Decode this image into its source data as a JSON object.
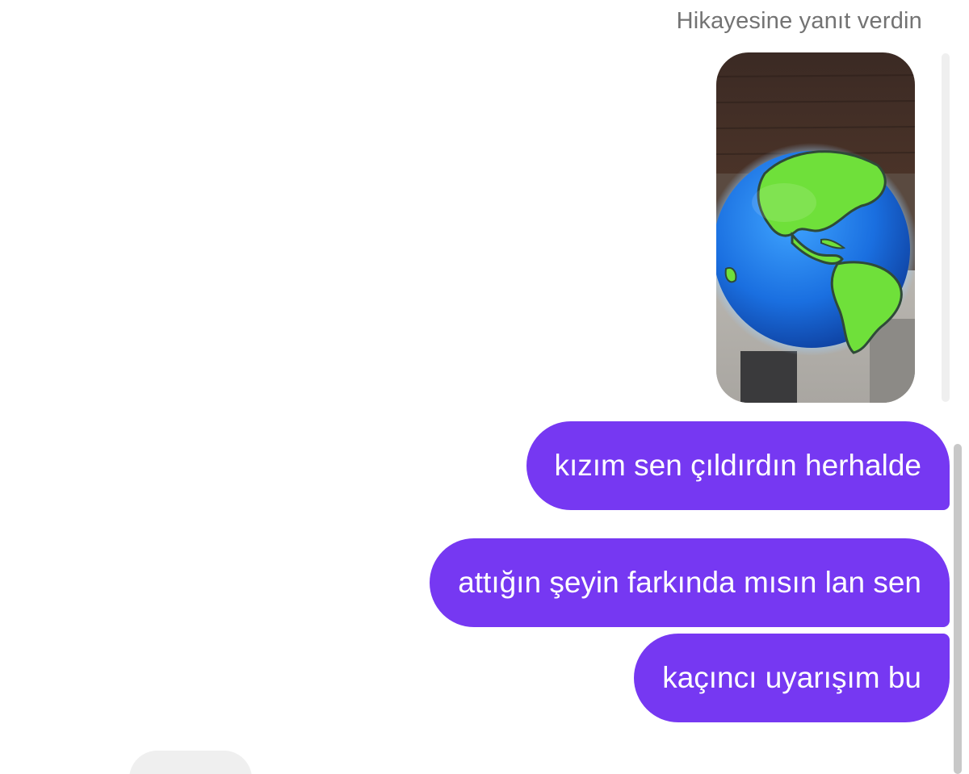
{
  "story_reply": {
    "caption": "Hikayesine yanıt verdin",
    "thumbnail_icon": "earth-globe-icon"
  },
  "messages": [
    {
      "text": "kızım sen çıldırdın herhalde",
      "sender": "me"
    },
    {
      "text": "attığın şeyin farkında mısın lan sen",
      "sender": "me"
    },
    {
      "text": "kaçıncı uyarışım bu",
      "sender": "me"
    }
  ],
  "colors": {
    "sent_bubble": "#7638f2",
    "caption_text": "#737373",
    "received_bubble": "#efefef"
  }
}
